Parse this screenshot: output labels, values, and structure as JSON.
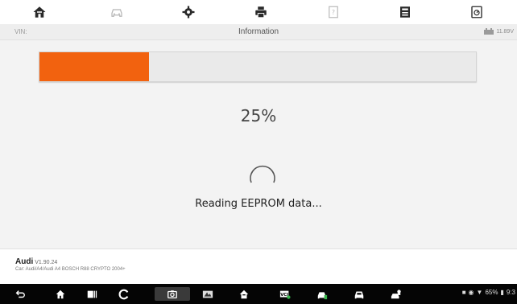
{
  "toolbar": {
    "items": [
      {
        "name": "home-icon"
      },
      {
        "name": "vehicle-swap-icon",
        "disabled": true
      },
      {
        "name": "settings-icon"
      },
      {
        "name": "print-icon"
      },
      {
        "name": "help-icon",
        "disabled": true
      },
      {
        "name": "save-icon"
      },
      {
        "name": "data-logging-icon"
      }
    ]
  },
  "infobar": {
    "vin_label": "VIN:",
    "title": "Information",
    "battery_voltage": "11.89V"
  },
  "progress": {
    "value_fraction": 0.25,
    "percent_text": "25%",
    "fill_color": "#f2620f"
  },
  "status_text": "Reading EEPROM data...",
  "footer": {
    "make": "Audi",
    "version": "V1.90.24",
    "car_info": "Car: Audi/A4/Audi A4 BOSCH R88 CRYPTO 2004+"
  },
  "navbar": {
    "items": [
      "back-icon",
      "home-icon",
      "recents-icon",
      "browser-icon",
      "camera-icon",
      "display-icon",
      "autel-home-icon",
      "vci-icon",
      "car-gas-icon",
      "car-icon",
      "car-repair-icon"
    ],
    "status": {
      "battery": "65%",
      "time": "9:3"
    }
  }
}
